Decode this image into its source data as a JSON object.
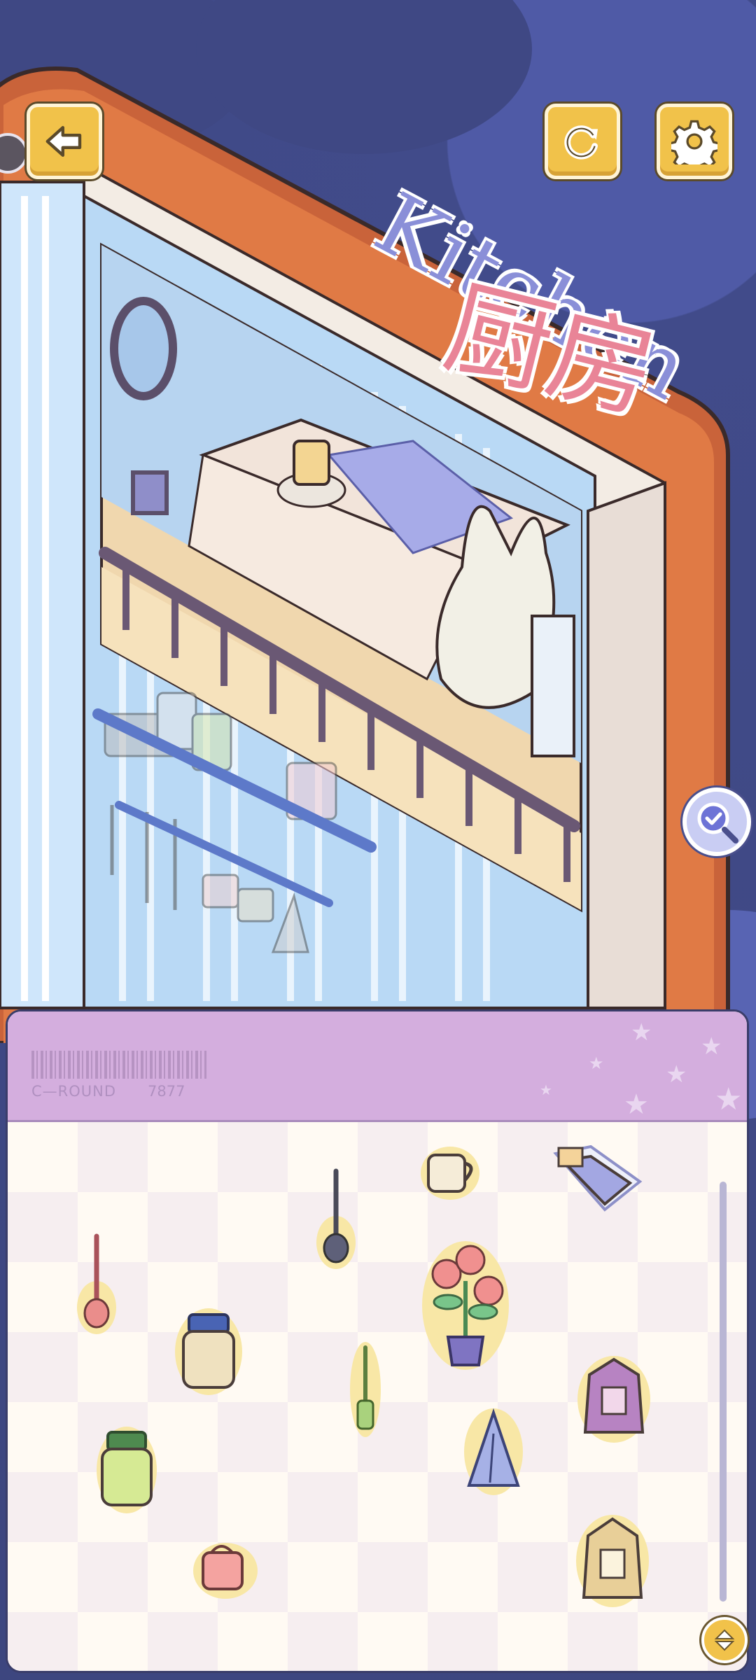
{
  "game": {
    "title_en": "Kitchen",
    "title_zh": "厨房"
  },
  "buttons": {
    "back": "back-arrow-icon",
    "restart": "restart-icon",
    "settings": "gear-icon",
    "hint": "magnifier-check-icon"
  },
  "inventory": {
    "round_label": "C—ROUND",
    "round_number": "7877",
    "items": [
      {
        "name": "mug-cream"
      },
      {
        "name": "tissue-box-purple"
      },
      {
        "name": "ladle-dark"
      },
      {
        "name": "ladle-red"
      },
      {
        "name": "potted-flower"
      },
      {
        "name": "jar-cream"
      },
      {
        "name": "spatula-green"
      },
      {
        "name": "bag-purple"
      },
      {
        "name": "jar-green"
      },
      {
        "name": "towel-blue"
      },
      {
        "name": "mug-pink"
      },
      {
        "name": "bag-tan"
      }
    ]
  },
  "colors": {
    "background": "#4a5494",
    "button_yellow": "#f1c24a",
    "panel_header": "#d4aede",
    "book_spine": "#c9633a"
  }
}
